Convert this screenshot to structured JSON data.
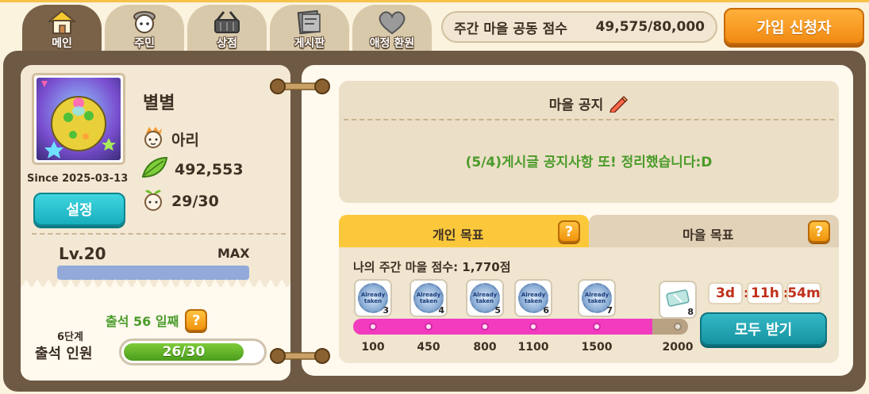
{
  "tabs": [
    {
      "label": "메인",
      "icon": "house-icon",
      "active": true
    },
    {
      "label": "주민",
      "icon": "villager-icon",
      "active": false
    },
    {
      "label": "상점",
      "icon": "basket-icon",
      "active": false
    },
    {
      "label": "게시판",
      "icon": "board-icon",
      "active": false
    },
    {
      "label": "애정 환원",
      "icon": "heart-icon",
      "active": false
    }
  ],
  "header": {
    "weekly_score_label": "주간 마을 공동 점수",
    "weekly_score_value": "49,575/80,000",
    "apply_button": "가입 신청자"
  },
  "profile": {
    "name": "별별",
    "role": "아리",
    "leaf_count": "492,553",
    "members": "29/30",
    "since": "Since 2025-03-13",
    "settings_button": "설정",
    "level": "Lv.20",
    "level_status": "MAX",
    "level_progress": 1.0
  },
  "attendance": {
    "days": "출석 56 일째",
    "help": "?",
    "stage": "6단계",
    "label": "출석 인원",
    "value": "26/30",
    "progress": 0.8667
  },
  "notice": {
    "title": "마을 공지",
    "text": "(5/4)게시글 공지사항 또! 정리했습니다:D"
  },
  "goals": {
    "personal_tab": "개인 목표",
    "village_tab": "마을 목표",
    "help": "?",
    "my_score": "나의 주간 마을 점수: 1,770점",
    "current": 1770,
    "max": 2000,
    "rewards": [
      {
        "threshold": "100",
        "value": 100,
        "count": "3",
        "stamp": "Already taken"
      },
      {
        "threshold": "450",
        "value": 450,
        "count": "4",
        "stamp": "Already taken"
      },
      {
        "threshold": "800",
        "value": 800,
        "count": "5",
        "stamp": "Already taken"
      },
      {
        "threshold": "1100",
        "value": 1100,
        "count": "6",
        "stamp": "Already taken"
      },
      {
        "threshold": "1500",
        "value": 1500,
        "count": "7",
        "stamp": "Already taken"
      },
      {
        "threshold": "2000",
        "value": 2000,
        "count": "8",
        "stamp": ""
      }
    ],
    "timer": {
      "days": "3d",
      "hours": "11h",
      "minutes": "54m"
    },
    "claim_button": "모두 받기"
  },
  "colors": {
    "frame": "#6e5945",
    "accent_orange": "#f18a12",
    "teal": "#16929f",
    "progress_pink": "#f23bbf",
    "notice_green": "#4a9b2a"
  }
}
